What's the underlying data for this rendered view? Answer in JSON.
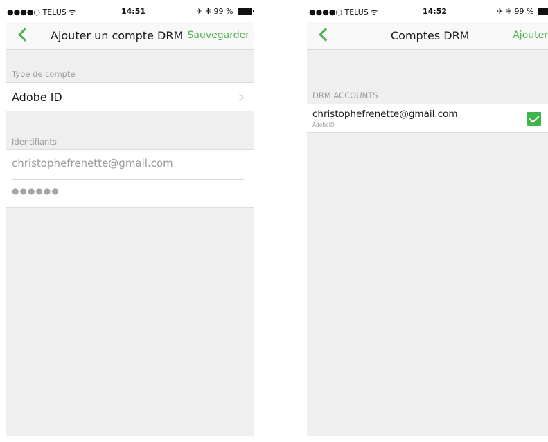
{
  "left_screen": {
    "status": {
      "carrier": "●●●●○ TELUS",
      "wifi": "ᯤ",
      "time": "14:51",
      "indicators": "✈ ✻",
      "battery": "99 %"
    },
    "nav": {
      "title": "Ajouter un compte DRM",
      "action": "Sauvegarder"
    },
    "account_type": {
      "section_label": "Type de compte",
      "value": "Adobe ID"
    },
    "credentials": {
      "section_label": "Identifiants",
      "email": "christophefrenette@gmail.com",
      "password": "●●●●●●"
    }
  },
  "right_screen": {
    "status": {
      "carrier": "●●●●○ TELUS",
      "wifi": "ᯤ",
      "time": "14:52",
      "indicators": "✈ ✻",
      "battery": "99 %"
    },
    "nav": {
      "title": "Comptes DRM",
      "action": "Ajouter"
    },
    "accounts": {
      "section_label": "DRM ACCOUNTS",
      "items": [
        {
          "email": "christophefrenette@gmail.com",
          "type": "AdobeID",
          "selected": true
        }
      ]
    }
  },
  "colors": {
    "accent": "#4db34d",
    "check": "#3fb54b",
    "background": "#efeff0"
  },
  "icons": {
    "back": "back-chevron-icon",
    "disclosure": "chevron-right-icon",
    "selected": "checkmark-icon"
  }
}
